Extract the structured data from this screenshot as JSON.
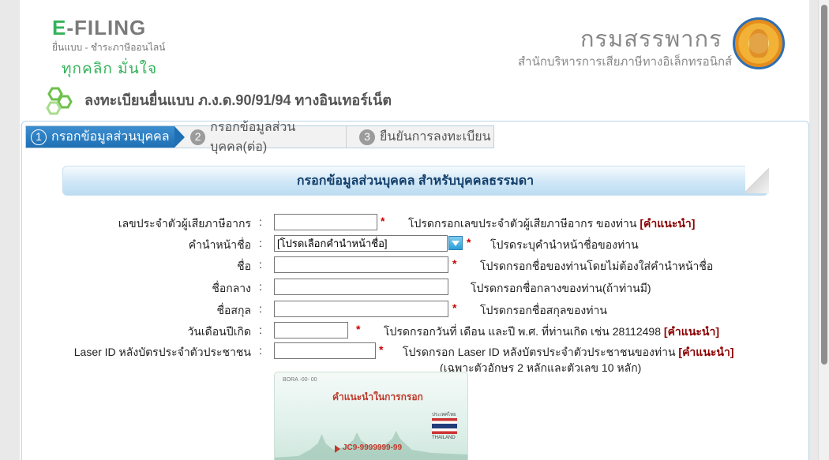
{
  "header": {
    "logo_e": "E",
    "logo_rest": "-FILING",
    "logo_sub": "ยื่นแบบ - ชำระภาษีออนไลน์",
    "slogan": "ทุกคลิก มั่นใจ",
    "dept_name": "กรมสรรพากร",
    "dept_sub": "สำนักบริหารการเสียภาษีทางอิเล็กทรอนิกส์"
  },
  "page_title": "ลงทะเบียนยื่นแบบ ภ.ง.ด.90/91/94 ทางอินเทอร์เน็ต",
  "steps": [
    {
      "num": "1",
      "label": "กรอกข้อมูลส่วนบุคคล",
      "active": true
    },
    {
      "num": "2",
      "label": "กรอกข้อมูลส่วนบุคคล(ต่อ)",
      "active": false
    },
    {
      "num": "3",
      "label": "ยืนยันการลงทะเบียน",
      "active": false
    }
  ],
  "section_title": "กรอกข้อมูลส่วนบุคคล สำหรับบุคคลธรรมดา",
  "form": {
    "colon": ":",
    "required_mark": "*",
    "advice_label": "[คำแนะนำ]",
    "fields": [
      {
        "label": "เลขประจำตัวผู้เสียภาษีอากร",
        "value": "",
        "hint": "โปรดกรอกเลขประจำตัวผู้เสียภาษีอากร ของท่าน"
      },
      {
        "label": "คำนำหน้าชื่อ",
        "value": "[โปรดเลือกคำนำหน้าชื่อ]",
        "hint": "โปรดระบุคำนำหน้าชื่อของท่าน"
      },
      {
        "label": "ชื่อ",
        "value": "",
        "hint": "โปรดกรอกชื่อของท่านโดยไม่ต้องใส่คำนำหน้าชื่อ"
      },
      {
        "label": "ชื่อกลาง",
        "value": "",
        "hint": "โปรดกรอกชื่อกลางของท่าน(ถ้าท่านมี)"
      },
      {
        "label": "ชื่อสกุล",
        "value": "",
        "hint": "โปรดกรอกชื่อสกุลของท่าน"
      },
      {
        "label": "วันเดือนปีเกิด",
        "value": "",
        "hint": "โปรดกรอกวันที่ เดือน และปี พ.ศ. ที่ท่านเกิด เช่น 28112498"
      },
      {
        "label": "Laser ID หลังบัตรประจำตัวประชาชน",
        "value": "",
        "hint": "โปรดกรอก Laser ID หลังบัตรประจำตัวประชาชนของท่าน",
        "hint2": "(เฉพาะตัวอักษร 2 หลักและตัวเลข 10 หลัก)"
      }
    ]
  },
  "laser_image": {
    "small_text": "BORA -00- 00",
    "caption": "คำแนะนำในการกรอก",
    "flag_caption": "ประเทศไทย",
    "country": "THAILAND",
    "code": "JC9-9999999-99"
  }
}
